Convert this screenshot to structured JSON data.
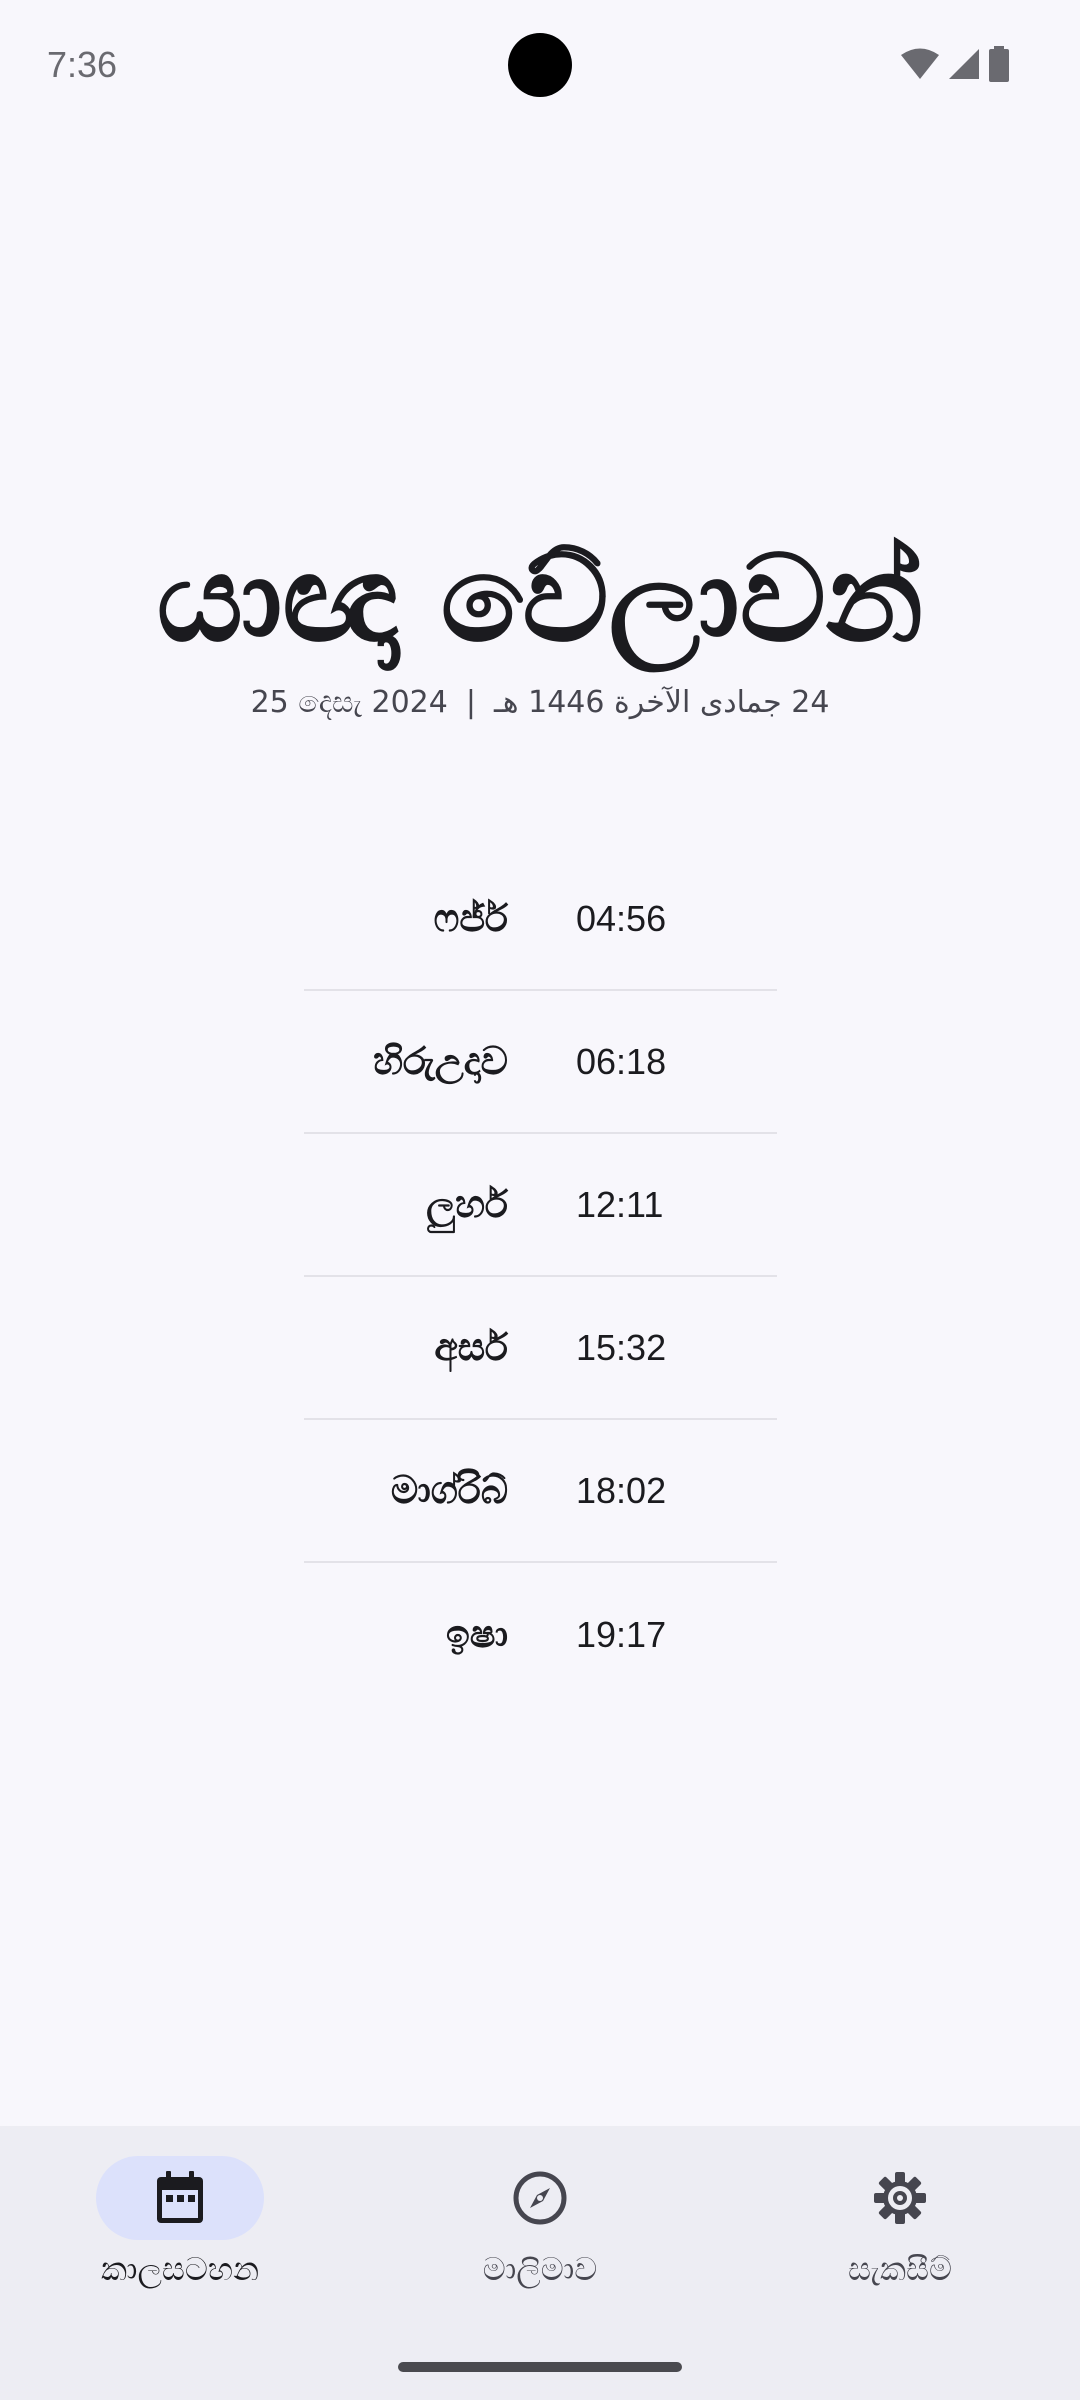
{
  "status_bar": {
    "time": "7:36"
  },
  "header": {
    "title": "යාඥා වේලාවන්",
    "gregorian_date": "25 දෙසැ 2024",
    "separator": "|",
    "hijri_date": "24 جمادى الآخرة 1446 هـ"
  },
  "prayers": [
    {
      "name": "ෆජ්ර්",
      "time": "04:56"
    },
    {
      "name": "හිරුඋදාව",
      "time": "06:18"
    },
    {
      "name": "ලුහර්",
      "time": "12:11"
    },
    {
      "name": "අසර්",
      "time": "15:32"
    },
    {
      "name": "මාග්රිබ්",
      "time": "18:02"
    },
    {
      "name": "ඉෂා",
      "time": "19:17"
    }
  ],
  "bottom_nav": {
    "items": [
      {
        "label": "කාලසටහන",
        "icon": "calendar-icon",
        "active": true
      },
      {
        "label": "මාලිමාව",
        "icon": "compass-icon",
        "active": false
      },
      {
        "label": "සැකසීම්",
        "icon": "gear-icon",
        "active": false
      }
    ]
  },
  "colors": {
    "background": "#f8f7fc",
    "nav_background": "#ededf3",
    "active_pill": "#dce1fb",
    "text_primary": "#1b1b1f",
    "divider": "#e3e2e8"
  }
}
